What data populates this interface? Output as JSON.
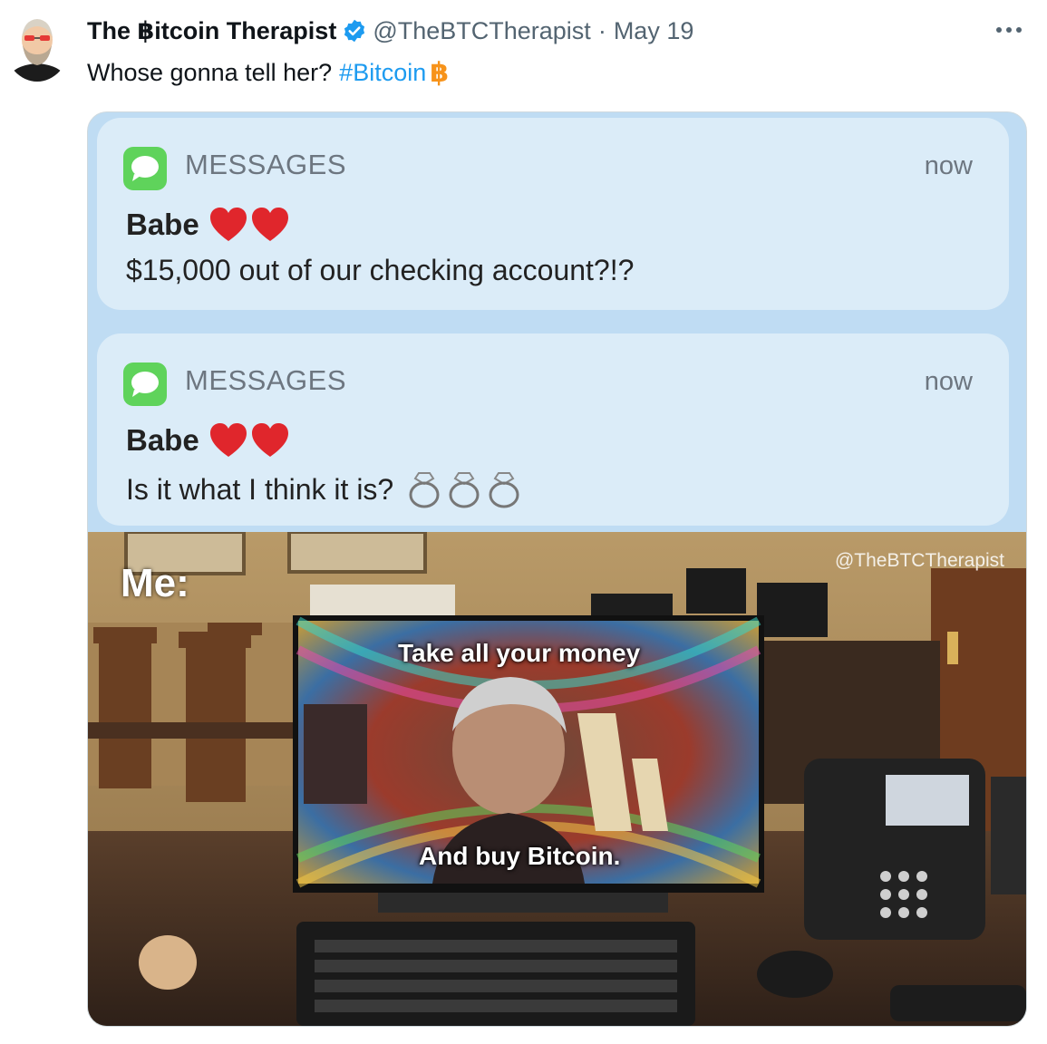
{
  "author": {
    "name": "The ฿itcoin Therapist",
    "handle": "@TheBTCTherapist",
    "separator": "·",
    "date": "May 19",
    "verified": true,
    "avatar_icon": "bearded-man-avatar-icon"
  },
  "more_label": "···",
  "tweet": {
    "text": "Whose gonna tell her?",
    "hashtag": "#Bitcoin",
    "emoji": "฿"
  },
  "notifications": [
    {
      "app": "MESSAGES",
      "time": "now",
      "sender": "Babe",
      "message": "$15,000 out of our checking account?!?"
    },
    {
      "app": "MESSAGES",
      "time": "now",
      "sender": "Babe",
      "message": "Is it what I think it is?"
    }
  ],
  "meme": {
    "label": "Me:",
    "watermark": "@TheBTCTherapist",
    "caption_top": "Take all your money",
    "caption_bottom": "And buy Bitcoin."
  },
  "colors": {
    "hashtag": "#1d9bf0",
    "bitcoin": "#f7931a",
    "verified": "#1d9bf0",
    "notification_bg": "#dbecf8",
    "messages_icon": "#5fd35b"
  }
}
